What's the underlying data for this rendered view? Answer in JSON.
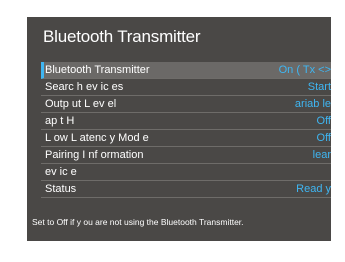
{
  "title": "Bluetooth Transmitter",
  "rows": [
    {
      "label": "Bluetooth Transmitter",
      "value": "On ( Tx",
      "arrows": "<>"
    },
    {
      "label": "Searc h    ev ic es",
      "value": "Start"
    },
    {
      "label": "Outp ut L ev el",
      "value": "ariab le"
    },
    {
      "label": "ap t    H",
      "value": "Off"
    },
    {
      "label": "L ow L atenc y  Mod e",
      "value": "Off"
    },
    {
      "label": "Pairing I  nf ormation",
      "value": "lear"
    },
    {
      "label": "  ev ic e",
      "value": ""
    },
    {
      "label": "Status",
      "value": "Read y"
    }
  ],
  "help_text": "Set to    Off    if  y ou are not using the Bluetooth Transmitter.",
  "colors": {
    "panel": "#4a4846",
    "accent": "#3fb6f2",
    "selected_row": "#6b6967"
  }
}
